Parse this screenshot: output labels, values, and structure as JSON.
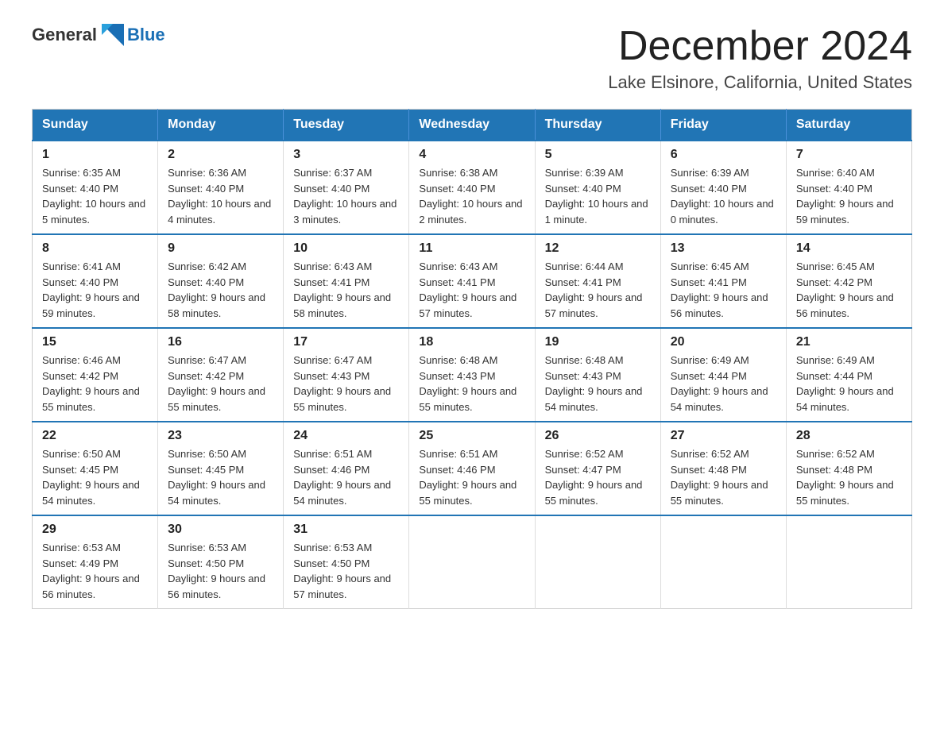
{
  "logo": {
    "general": "General",
    "blue": "Blue"
  },
  "title": {
    "month": "December 2024",
    "location": "Lake Elsinore, California, United States"
  },
  "weekdays": [
    "Sunday",
    "Monday",
    "Tuesday",
    "Wednesday",
    "Thursday",
    "Friday",
    "Saturday"
  ],
  "weeks": [
    [
      {
        "day": 1,
        "sunrise": "6:35 AM",
        "sunset": "4:40 PM",
        "daylight": "10 hours and 5 minutes."
      },
      {
        "day": 2,
        "sunrise": "6:36 AM",
        "sunset": "4:40 PM",
        "daylight": "10 hours and 4 minutes."
      },
      {
        "day": 3,
        "sunrise": "6:37 AM",
        "sunset": "4:40 PM",
        "daylight": "10 hours and 3 minutes."
      },
      {
        "day": 4,
        "sunrise": "6:38 AM",
        "sunset": "4:40 PM",
        "daylight": "10 hours and 2 minutes."
      },
      {
        "day": 5,
        "sunrise": "6:39 AM",
        "sunset": "4:40 PM",
        "daylight": "10 hours and 1 minute."
      },
      {
        "day": 6,
        "sunrise": "6:39 AM",
        "sunset": "4:40 PM",
        "daylight": "10 hours and 0 minutes."
      },
      {
        "day": 7,
        "sunrise": "6:40 AM",
        "sunset": "4:40 PM",
        "daylight": "9 hours and 59 minutes."
      }
    ],
    [
      {
        "day": 8,
        "sunrise": "6:41 AM",
        "sunset": "4:40 PM",
        "daylight": "9 hours and 59 minutes."
      },
      {
        "day": 9,
        "sunrise": "6:42 AM",
        "sunset": "4:40 PM",
        "daylight": "9 hours and 58 minutes."
      },
      {
        "day": 10,
        "sunrise": "6:43 AM",
        "sunset": "4:41 PM",
        "daylight": "9 hours and 58 minutes."
      },
      {
        "day": 11,
        "sunrise": "6:43 AM",
        "sunset": "4:41 PM",
        "daylight": "9 hours and 57 minutes."
      },
      {
        "day": 12,
        "sunrise": "6:44 AM",
        "sunset": "4:41 PM",
        "daylight": "9 hours and 57 minutes."
      },
      {
        "day": 13,
        "sunrise": "6:45 AM",
        "sunset": "4:41 PM",
        "daylight": "9 hours and 56 minutes."
      },
      {
        "day": 14,
        "sunrise": "6:45 AM",
        "sunset": "4:42 PM",
        "daylight": "9 hours and 56 minutes."
      }
    ],
    [
      {
        "day": 15,
        "sunrise": "6:46 AM",
        "sunset": "4:42 PM",
        "daylight": "9 hours and 55 minutes."
      },
      {
        "day": 16,
        "sunrise": "6:47 AM",
        "sunset": "4:42 PM",
        "daylight": "9 hours and 55 minutes."
      },
      {
        "day": 17,
        "sunrise": "6:47 AM",
        "sunset": "4:43 PM",
        "daylight": "9 hours and 55 minutes."
      },
      {
        "day": 18,
        "sunrise": "6:48 AM",
        "sunset": "4:43 PM",
        "daylight": "9 hours and 55 minutes."
      },
      {
        "day": 19,
        "sunrise": "6:48 AM",
        "sunset": "4:43 PM",
        "daylight": "9 hours and 54 minutes."
      },
      {
        "day": 20,
        "sunrise": "6:49 AM",
        "sunset": "4:44 PM",
        "daylight": "9 hours and 54 minutes."
      },
      {
        "day": 21,
        "sunrise": "6:49 AM",
        "sunset": "4:44 PM",
        "daylight": "9 hours and 54 minutes."
      }
    ],
    [
      {
        "day": 22,
        "sunrise": "6:50 AM",
        "sunset": "4:45 PM",
        "daylight": "9 hours and 54 minutes."
      },
      {
        "day": 23,
        "sunrise": "6:50 AM",
        "sunset": "4:45 PM",
        "daylight": "9 hours and 54 minutes."
      },
      {
        "day": 24,
        "sunrise": "6:51 AM",
        "sunset": "4:46 PM",
        "daylight": "9 hours and 54 minutes."
      },
      {
        "day": 25,
        "sunrise": "6:51 AM",
        "sunset": "4:46 PM",
        "daylight": "9 hours and 55 minutes."
      },
      {
        "day": 26,
        "sunrise": "6:52 AM",
        "sunset": "4:47 PM",
        "daylight": "9 hours and 55 minutes."
      },
      {
        "day": 27,
        "sunrise": "6:52 AM",
        "sunset": "4:48 PM",
        "daylight": "9 hours and 55 minutes."
      },
      {
        "day": 28,
        "sunrise": "6:52 AM",
        "sunset": "4:48 PM",
        "daylight": "9 hours and 55 minutes."
      }
    ],
    [
      {
        "day": 29,
        "sunrise": "6:53 AM",
        "sunset": "4:49 PM",
        "daylight": "9 hours and 56 minutes."
      },
      {
        "day": 30,
        "sunrise": "6:53 AM",
        "sunset": "4:50 PM",
        "daylight": "9 hours and 56 minutes."
      },
      {
        "day": 31,
        "sunrise": "6:53 AM",
        "sunset": "4:50 PM",
        "daylight": "9 hours and 57 minutes."
      },
      null,
      null,
      null,
      null
    ]
  ]
}
